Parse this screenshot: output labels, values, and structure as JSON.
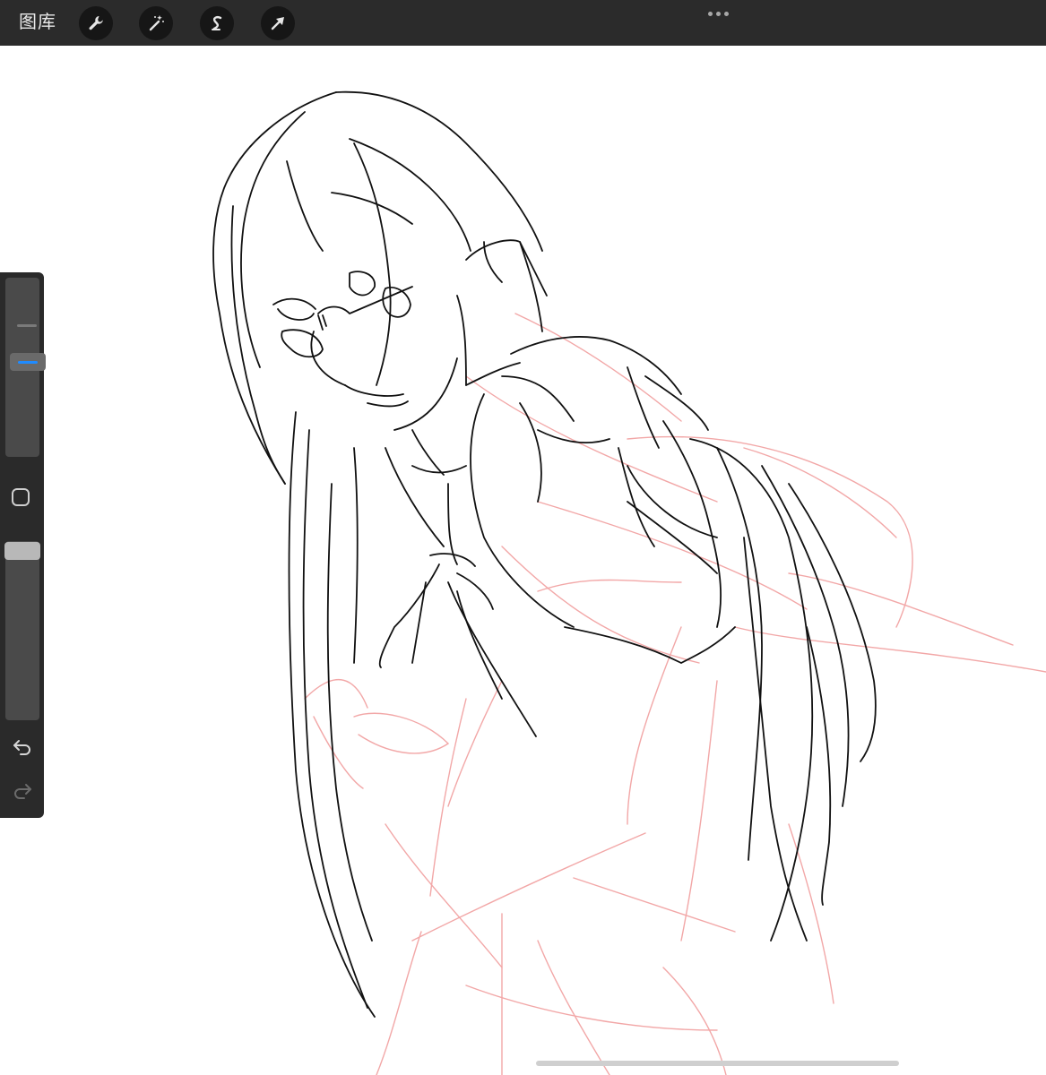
{
  "toolbar": {
    "gallery_label": "图库",
    "tools": [
      {
        "icon": "wrench-icon"
      },
      {
        "icon": "magic-wand-icon"
      },
      {
        "icon": "selection-s-icon"
      },
      {
        "icon": "transform-arrow-icon"
      }
    ],
    "more_icon": "ellipsis-icon"
  },
  "sidebar": {
    "brush_size": 0.57,
    "opacity": 1.0,
    "accent": "#1f8bff",
    "undo_icon": "undo-icon",
    "redo_icon": "redo-icon",
    "modify_icon": "square-modify-icon"
  },
  "colors": {
    "topbar": "#2b2b2b",
    "ink": "#111111",
    "sketch": "#f2a7a7",
    "canvas": "#ffffff"
  }
}
